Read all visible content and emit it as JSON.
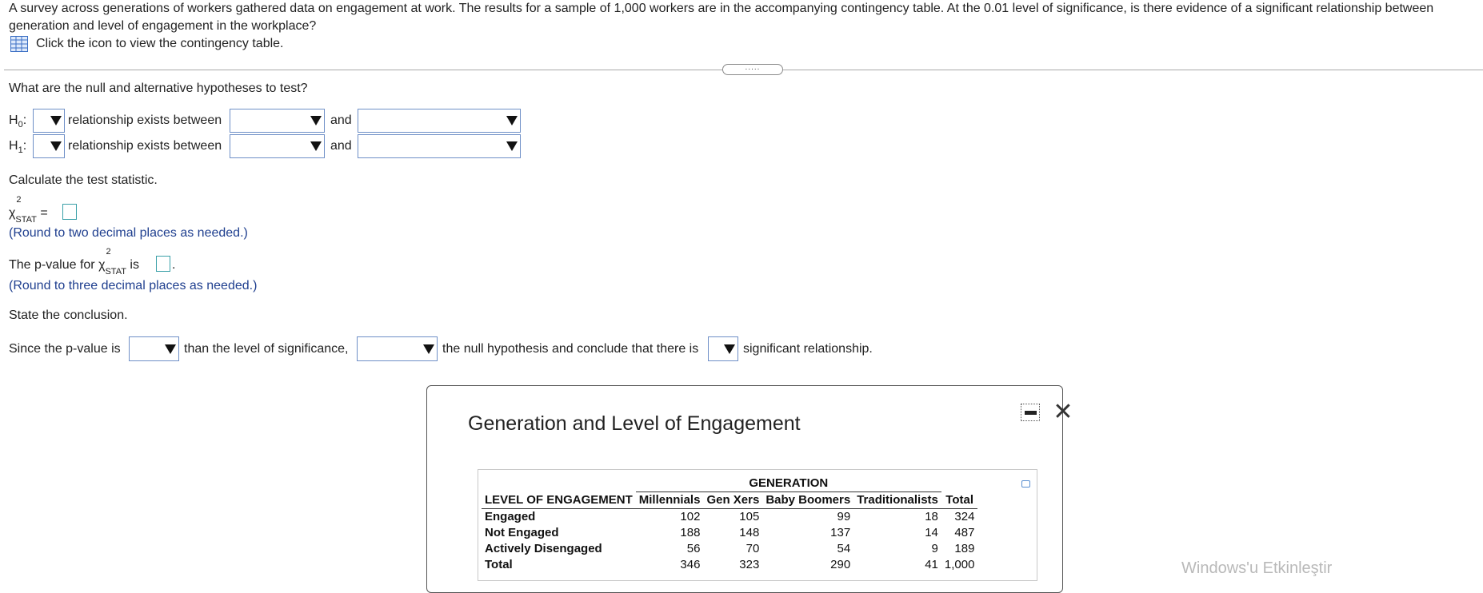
{
  "question": {
    "text": "A survey across generations of workers gathered data on engagement at work. The results for a sample of 1,000 workers are in the accompanying contingency table. At the 0.01 level of significance, is there evidence of a significant relationship between generation and level of engagement in the workplace?",
    "icon_link": "Click the icon to view the contingency table."
  },
  "divider_handle": ".....",
  "hypotheses": {
    "prompt": "What are the null and alternative hypotheses to test?",
    "h0_label": "H",
    "h0_sub": "0",
    "h1_label": "H",
    "h1_sub": "1",
    "colon": ":",
    "relationship_text": "relationship exists between",
    "and_text": "and"
  },
  "statistic": {
    "prompt": "Calculate the test statistic.",
    "chi": "χ",
    "sup": "2",
    "sub": "STAT",
    "equals": "=",
    "round_hint": "(Round to two decimal places as needed.)"
  },
  "pvalue": {
    "prefix": "The p-value for",
    "suffix": "is",
    "period": ".",
    "round_hint": "(Round to three decimal places as needed.)"
  },
  "conclusion": {
    "prompt": "State the conclusion.",
    "part1": "Since the p-value is",
    "part2": "than the level of significance,",
    "part3": "the null hypothesis and conclude that there is",
    "part4": "significant relationship."
  },
  "popup": {
    "title": "Generation and Level of Engagement",
    "table": {
      "group_header": "GENERATION",
      "row_header": "LEVEL OF ENGAGEMENT",
      "columns": [
        "Millennials",
        "Gen Xers",
        "Baby Boomers",
        "Traditionalists",
        "Total"
      ],
      "rows": [
        {
          "label": "Engaged",
          "values": [
            "102",
            "105",
            "99",
            "18",
            "324"
          ]
        },
        {
          "label": "Not Engaged",
          "values": [
            "188",
            "148",
            "137",
            "14",
            "487"
          ]
        },
        {
          "label": "Actively Disengaged",
          "values": [
            "56",
            "70",
            "54",
            "9",
            "189"
          ]
        },
        {
          "label": "Total",
          "values": [
            "346",
            "323",
            "290",
            "41",
            "1,000"
          ]
        }
      ]
    }
  },
  "watermark": "Windows'u Etkinleştir"
}
